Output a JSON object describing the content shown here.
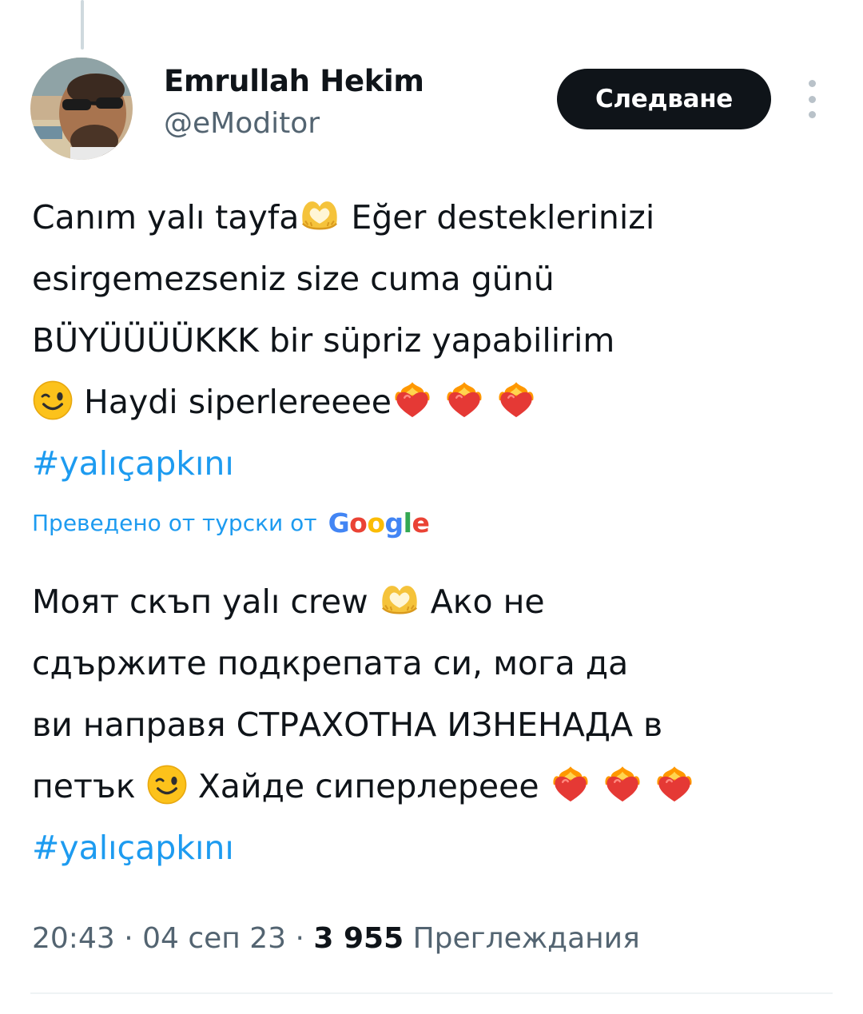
{
  "tweet": {
    "author": {
      "display_name": "Emrullah Hekim",
      "handle": "@eModitor",
      "avatar": "profile-photo"
    },
    "follow_button_label": "Следване",
    "more_icon": "vertical-dots-icon",
    "original_text": {
      "lines": [
        {
          "before": "Canım yalı tayfa",
          "emoji": "heart-hands",
          "after": " Eğer desteklerinizi"
        },
        {
          "text": "esirgemezseniz size cuma günü"
        },
        {
          "text": "BÜYÜÜÜÜKKK bir süpriz yapabilirim"
        },
        {
          "emoji": "winking-face",
          "after": " Haydi siperlereeee"
        }
      ],
      "trailing_emojis": [
        "heart-on-fire",
        "heart-on-fire",
        "heart-on-fire"
      ],
      "hashtag": "#yalıçapkını"
    },
    "translation": {
      "label": "Преведено от турски от",
      "provider": "Google"
    },
    "translated_text": {
      "lines": [
        {
          "before": "Моят скъп yalı crew ",
          "emoji": "heart-hands",
          "after": " Ако не"
        },
        {
          "text": "сдържите подкрепата си, мога да"
        },
        {
          "text": "ви направя СТРАХОТНА ИЗНЕНАДА в"
        },
        {
          "before": "петък ",
          "emoji": "winking-face",
          "after": " Хайде сиперлереее "
        }
      ],
      "trailing_emojis": [
        "heart-on-fire",
        "heart-on-fire",
        "heart-on-fire"
      ],
      "hashtag": "#yalıçapkını"
    },
    "meta": {
      "time": "20:43",
      "separator": " · ",
      "date": "04 сеп 23",
      "views_count": "3 955",
      "views_label": "Преглеждания"
    },
    "colors": {
      "link": "#1d9bf0",
      "text": "#0f1419",
      "secondary": "#536471",
      "button_bg": "#0f1419"
    }
  }
}
